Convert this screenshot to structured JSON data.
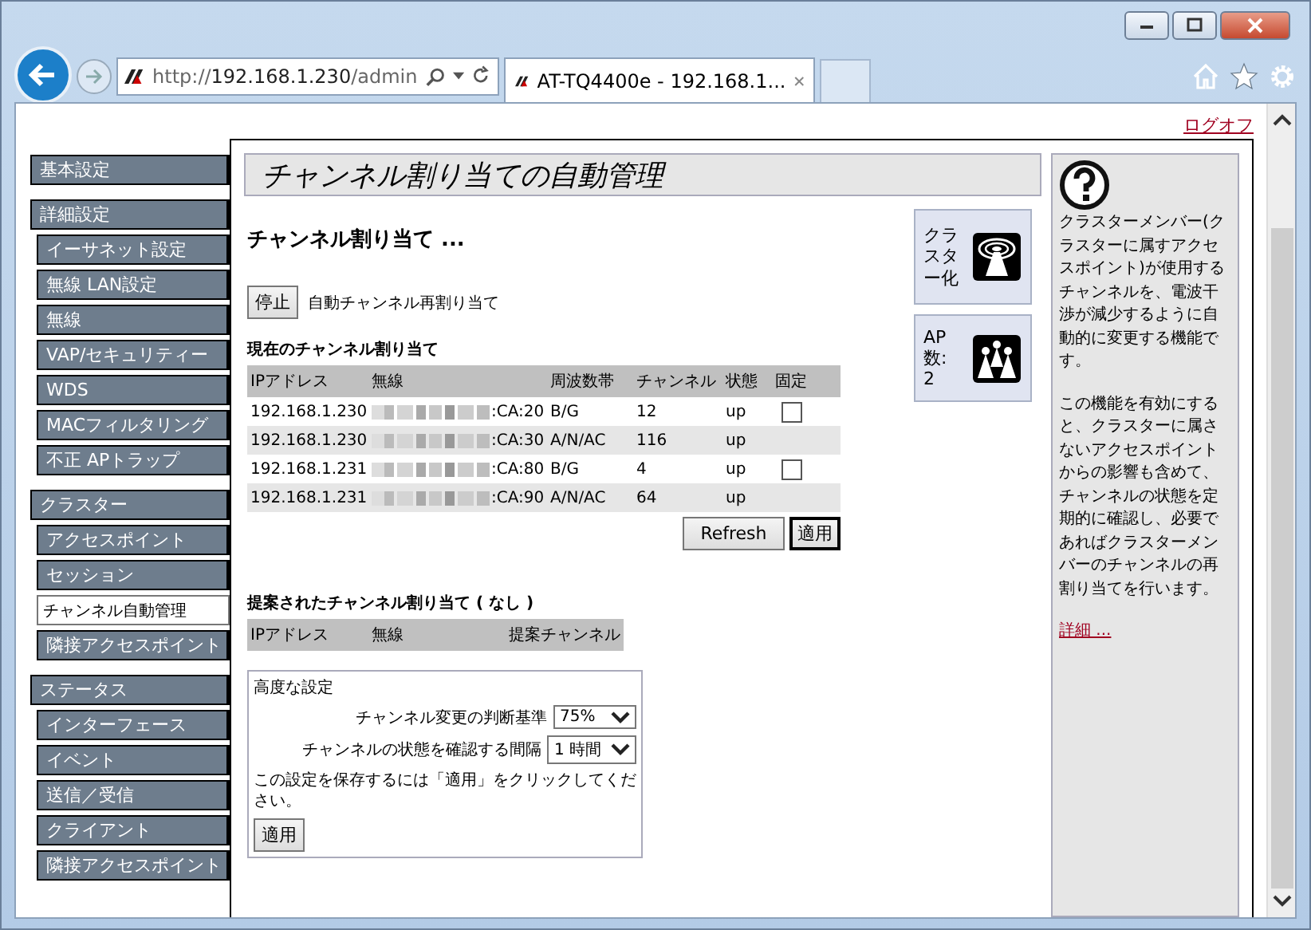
{
  "address_bar": {
    "url_scheme": "http://",
    "url_host": "192.168.1.230",
    "url_path": "/admin"
  },
  "tab": {
    "title": "AT-TQ4400e - 192.168.1..."
  },
  "logoff": "ログオフ",
  "sidebar": [
    {
      "label": "基本設定",
      "selected": false
    },
    {
      "label": "詳細設定",
      "selected": false,
      "children": [
        {
          "label": "イーサネット設定",
          "selected": false
        },
        {
          "label": "無線 LAN設定",
          "selected": false
        },
        {
          "label": "無線",
          "selected": false
        },
        {
          "label": "VAP/セキュリティー",
          "selected": false
        },
        {
          "label": "WDS",
          "selected": false
        },
        {
          "label": "MACフィルタリング",
          "selected": false
        },
        {
          "label": "不正 APトラップ",
          "selected": false
        }
      ]
    },
    {
      "label": "クラスター",
      "selected": false,
      "children": [
        {
          "label": "アクセスポイント",
          "selected": false
        },
        {
          "label": "セッション",
          "selected": false
        },
        {
          "label": "チャンネル自動管理",
          "selected": true
        },
        {
          "label": "隣接アクセスポイント",
          "selected": false
        }
      ]
    },
    {
      "label": "ステータス",
      "selected": false,
      "children": [
        {
          "label": "インターフェース",
          "selected": false
        },
        {
          "label": "イベント",
          "selected": false
        },
        {
          "label": "送信／受信",
          "selected": false
        },
        {
          "label": "クライアント",
          "selected": false
        },
        {
          "label": "隣接アクセスポイント",
          "selected": false
        }
      ]
    }
  ],
  "page_title": "チャンネル割り当ての自動管理",
  "section_title": "チャンネル割り当て ...",
  "stop_button": "停止",
  "stop_label": "自動チャンネル再割り当て",
  "current": {
    "title": "現在のチャンネル割り当て",
    "columns": [
      "IPアドレス",
      "無線",
      "周波数帯",
      "チャンネル",
      "状態",
      "固定"
    ],
    "rows": [
      {
        "ip": "192.168.1.230",
        "mac_suffix": ":CA:20",
        "band": "B/G",
        "channel": "12",
        "status": "up",
        "checked": false
      },
      {
        "ip": "192.168.1.230",
        "mac_suffix": ":CA:30",
        "band": "A/N/AC",
        "channel": "116",
        "status": "up"
      },
      {
        "ip": "192.168.1.231",
        "mac_suffix": ":CA:80",
        "band": "B/G",
        "channel": "4",
        "status": "up",
        "checked": false
      },
      {
        "ip": "192.168.1.231",
        "mac_suffix": ":CA:90",
        "band": "A/N/AC",
        "channel": "64",
        "status": "up"
      }
    ]
  },
  "refresh_button": "Refresh",
  "apply_button": "適用",
  "proposed": {
    "title": "提案されたチャンネル割り当て ( なし )",
    "columns": [
      "IPアドレス",
      "無線",
      "提案チャンネル"
    ]
  },
  "advanced": {
    "title": "高度な設定",
    "fields": [
      {
        "label": "チャンネル変更の判断基準",
        "value": "75%"
      },
      {
        "label": "チャンネルの状態を確認する間隔",
        "value": "1 時間"
      }
    ],
    "note": "この設定を保存するには「適用」をクリックしてください。",
    "apply_button": "適用"
  },
  "status_cards": [
    {
      "kind": "cluster",
      "label": "クラスター化"
    },
    {
      "kind": "ap_count",
      "label": "AP数: 2"
    }
  ],
  "help": {
    "paragraphs": [
      "クラスターメンバー(クラスターに属すアクセスポイント)が使用するチャンネルを、電波干渉が減少するように自動的に変更する機能です。",
      "この機能を有効にすると、クラスターに属さないアクセスポイントからの影響も含めて、チャンネルの状態を定期的に確認し、必要であればクラスターメンバーのチャンネルの再割り当てを行います。"
    ],
    "link": "詳細 ..."
  }
}
